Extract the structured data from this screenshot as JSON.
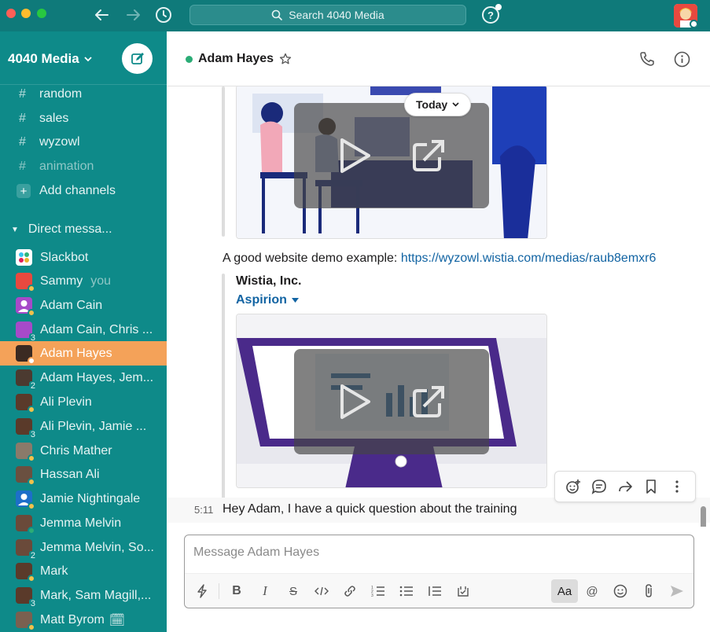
{
  "window": {
    "search_placeholder": "Search 4040 Media",
    "help_label": "?"
  },
  "workspace": {
    "name": "4040 Media"
  },
  "sidebar": {
    "channels": [
      {
        "label": "random",
        "muted": false
      },
      {
        "label": "sales",
        "muted": false
      },
      {
        "label": "wyzowl",
        "muted": false
      },
      {
        "label": "animation",
        "muted": true
      }
    ],
    "add_channels_label": "Add channels",
    "dm_section_label": "Direct messa...",
    "dms": [
      {
        "label": "Slackbot",
        "status": "none",
        "count": ""
      },
      {
        "label": "Sammy",
        "suffix": "you",
        "status": "off",
        "count": ""
      },
      {
        "label": "Adam Cain",
        "status": "off",
        "count": ""
      },
      {
        "label": "Adam Cain, Chris ...",
        "status": "none",
        "count": "3"
      },
      {
        "label": "Adam Hayes",
        "status": "wh",
        "count": "",
        "active": true
      },
      {
        "label": "Adam Hayes, Jem...",
        "status": "none",
        "count": "2"
      },
      {
        "label": "Ali Plevin",
        "status": "off",
        "count": ""
      },
      {
        "label": "Ali Plevin, Jamie ...",
        "status": "none",
        "count": "3"
      },
      {
        "label": "Chris Mather",
        "status": "off",
        "count": ""
      },
      {
        "label": "Hassan Ali",
        "status": "off",
        "count": ""
      },
      {
        "label": "Jamie Nightingale",
        "status": "off",
        "count": ""
      },
      {
        "label": "Jemma Melvin",
        "status": "on",
        "count": ""
      },
      {
        "label": "Jemma Melvin, So...",
        "status": "none",
        "count": "2"
      },
      {
        "label": "Mark",
        "status": "off",
        "count": ""
      },
      {
        "label": "Mark, Sam Magill,...",
        "status": "none",
        "count": "3"
      },
      {
        "label": "Matt Byrom",
        "status": "off",
        "count": "",
        "emoji": "🗓"
      }
    ]
  },
  "channel": {
    "title": "Adam Hayes"
  },
  "messages": {
    "date_divider": "Today",
    "link_prefix": "A good website demo example: ",
    "link_url": "https://wyzowl.wistia.com/medias/raub8emxr6",
    "unfurl_site": "Wistia, Inc.",
    "unfurl_title": "Aspirion",
    "last_time": "5:11",
    "last_text": "Hey Adam, I have a quick question about the training"
  },
  "composer": {
    "placeholder": "Message Adam Hayes",
    "format_toggle": "Aa",
    "mention": "@"
  },
  "colors": {
    "titlebar": "#0f7a7a",
    "sidebar": "#0e8a89",
    "active_item": "#f4a259",
    "link": "#1264a3",
    "presence_online": "#2bac76"
  }
}
